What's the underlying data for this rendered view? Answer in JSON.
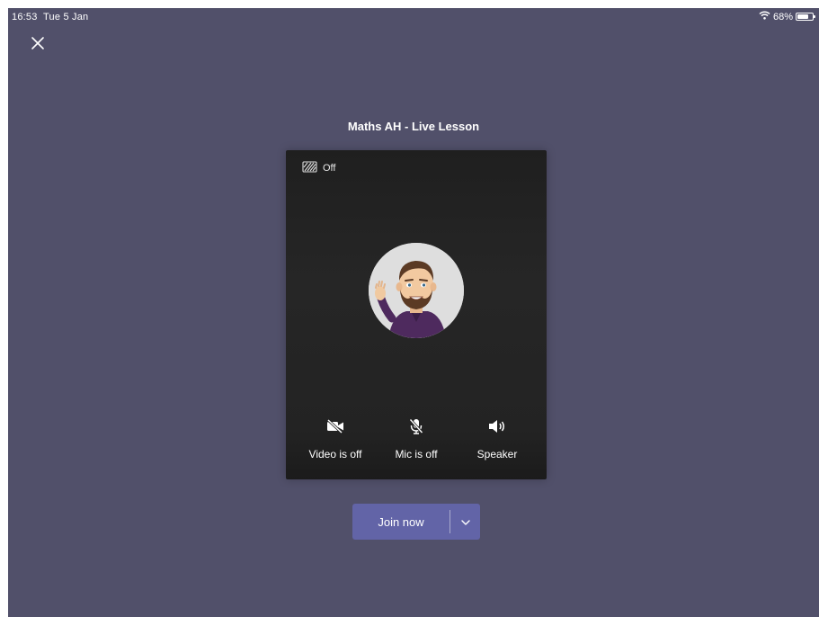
{
  "status_bar": {
    "time": "16:53",
    "date": "Tue 5 Jan",
    "battery": "68%"
  },
  "icons": {
    "close": "close-icon",
    "background_effects": "background-effects-icon",
    "video_off": "video-off-icon",
    "mic_off": "mic-off-icon",
    "speaker": "speaker-icon",
    "dropdown": "chevron-down-icon",
    "wifi": "wifi-icon",
    "battery": "battery-icon"
  },
  "meeting": {
    "title": "Maths AH - Live Lesson"
  },
  "preview": {
    "background_effects_label": "Off",
    "avatar": "bitmoji avatar waving",
    "controls": [
      {
        "label": "Video is off"
      },
      {
        "label": "Mic is off"
      },
      {
        "label": "Speaker"
      }
    ]
  },
  "join": {
    "label": "Join now"
  },
  "colors": {
    "background": "#51506a",
    "preview_panel": "#242424",
    "join_button": "#6264a7"
  }
}
